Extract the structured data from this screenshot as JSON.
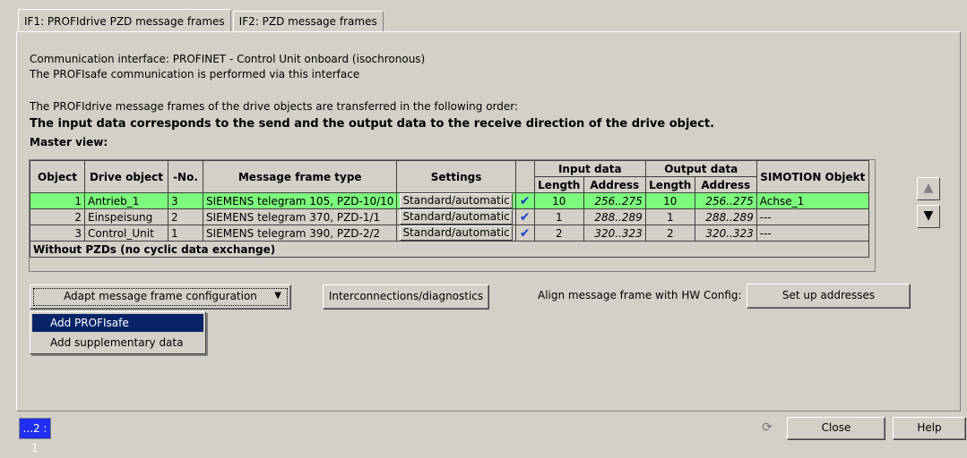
{
  "tabs": [
    {
      "label": "IF1:  PROFIdrive  PZD message frames"
    },
    {
      "label": "IF2:  PZD message frames"
    }
  ],
  "info": {
    "line1": "Communication interface: PROFINET - Control Unit onboard (isochronous)",
    "line2": "The PROFIsafe communication is performed via this interface",
    "line3": "The PROFIdrive message frames of the drive objects are transferred in the following order:",
    "line4": "The input data corresponds to the send and the output data to the receive direction of the drive object.",
    "master_view": "Master view:"
  },
  "table": {
    "headers": {
      "object": "Object",
      "drive_object": "Drive object",
      "no": "-No.",
      "message_frame_type": "Message frame type",
      "settings": "Settings",
      "input_data": "Input data",
      "output_data": "Output data",
      "simotion": "SIMOTION Objekt",
      "length": "Length",
      "address": "Address"
    },
    "rows": [
      {
        "object": "1",
        "drive_object": "Antrieb_1",
        "no": "3",
        "type": "SIEMENS telegram 105, PZD-10/10",
        "settings": "Standard/automatic",
        "in_len": "10",
        "in_addr": "256..275",
        "out_len": "10",
        "out_addr": "256..275",
        "simotion": "Achse_1"
      },
      {
        "object": "2",
        "drive_object": "Einspeisung",
        "no": "2",
        "type": "SIEMENS telegram 370, PZD-1/1",
        "settings": "Standard/automatic",
        "in_len": "1",
        "in_addr": "288..289",
        "out_len": "1",
        "out_addr": "288..289",
        "simotion": "---"
      },
      {
        "object": "3",
        "drive_object": "Control_Unit",
        "no": "1",
        "type": "SIEMENS telegram 390, PZD-2/2",
        "settings": "Standard/automatic",
        "in_len": "2",
        "in_addr": "320..323",
        "out_len": "2",
        "out_addr": "320..323",
        "simotion": "---"
      }
    ],
    "footer": "Without PZDs (no cyclic data exchange)"
  },
  "buttons": {
    "adapt": "Adapt message frame configuration",
    "interconnections": "Interconnections/diagnostics",
    "align_label": "Align message frame with HW Config:",
    "setup": "Set up addresses",
    "close": "Close",
    "help": "Help"
  },
  "menu": {
    "items": [
      "Add PROFIsafe",
      "Add supplementary data"
    ]
  },
  "status": {
    "box": "...2 : 1"
  }
}
